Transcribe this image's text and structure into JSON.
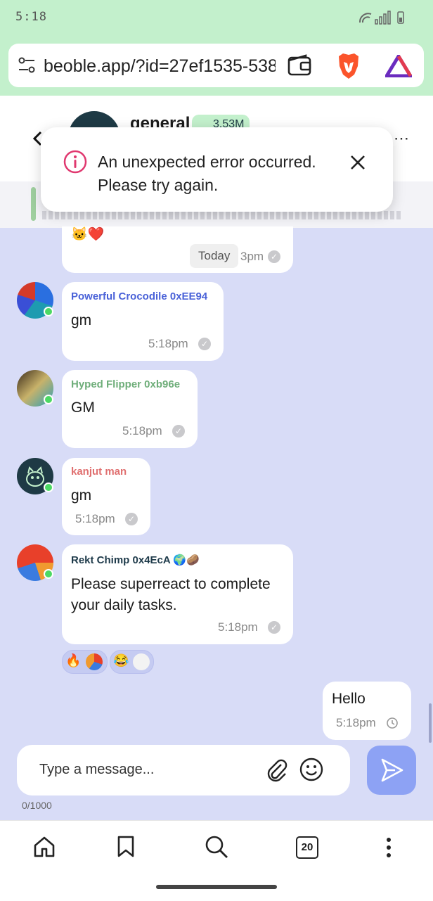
{
  "status_bar": {
    "time": "5:18"
  },
  "browser": {
    "url": "beoble.app/?id=27ef1535-538"
  },
  "channel": {
    "name": "general",
    "member_count": "3.53M"
  },
  "toast": {
    "message_line1": "An unexpected error occurred.",
    "message_line2": "Please try again."
  },
  "date_chip": "Today",
  "messages": [
    {
      "sender": "Powerful Crocodile 0xEE94",
      "text": "gm",
      "time": "5:18pm",
      "sender_color": "#4a62d8"
    },
    {
      "sender": "Hyped Flipper 0xb96e",
      "text": "GM",
      "time": "5:18pm",
      "sender_color": "#6fae7a"
    },
    {
      "sender": "kanjut man",
      "text": "gm",
      "time": "5:18pm",
      "sender_color": "#e07070"
    },
    {
      "sender": "Rekt Chimp 0x4EcA",
      "sender_emojis": "🌍🥔",
      "text_line1": "Please superreact to complete",
      "text_line2": "your daily tasks.",
      "time": "5:18pm",
      "sender_color": "#1e3a4a"
    }
  ],
  "top_message": {
    "emojis": "🐱❤️",
    "time_partial": "3pm"
  },
  "reactions": [
    "🔥",
    "😂"
  ],
  "own_message": {
    "text": "Hello",
    "time": "5:18pm"
  },
  "composer": {
    "placeholder": "Type a message...",
    "char_count": "0/1000"
  },
  "nav": {
    "tab_count": "20"
  },
  "colors": {
    "accent": "#8da2f4",
    "status_bar_bg": "#c3f0cc",
    "chat_bg": "#d8dcf7",
    "error": "#e0386f"
  }
}
